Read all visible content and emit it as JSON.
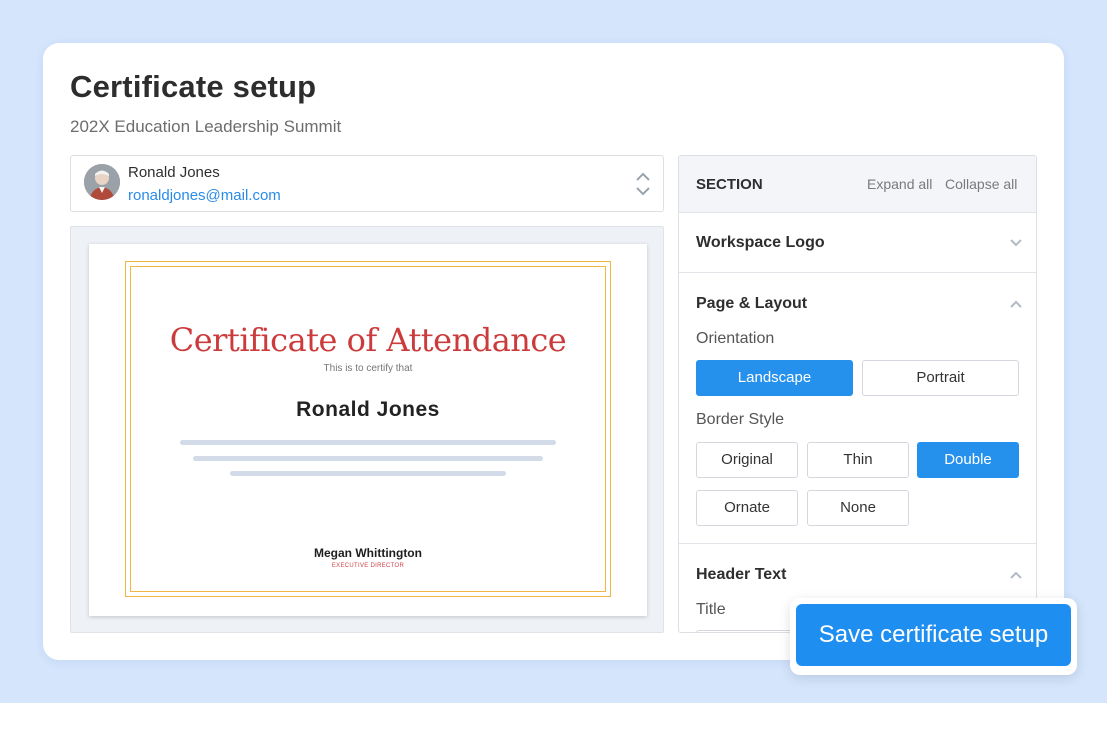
{
  "page": {
    "title": "Certificate setup",
    "subtitle": "202X Education Leadership Summit"
  },
  "user": {
    "name": "Ronald Jones",
    "email": "ronaldjones@mail.com"
  },
  "certificate": {
    "title": "Certificate of Attendance",
    "subtitle": "This is to certify that",
    "recipient": "Ronald  Jones",
    "signer_name": "Megan Whittington",
    "signer_role": "EXECUTIVE DIRECTOR",
    "border_color": "#f2b640",
    "title_color": "#cc3b3b"
  },
  "panel": {
    "header_label": "SECTION",
    "expand_all": "Expand all",
    "collapse_all": "Collapse all",
    "sections": {
      "workspace_logo": {
        "title": "Workspace Logo",
        "state": "collapsed"
      },
      "page_layout": {
        "title": "Page & Layout",
        "state": "expanded",
        "orientation_label": "Orientation",
        "orientation_options": [
          "Landscape",
          "Portrait"
        ],
        "orientation_selected": "Landscape",
        "border_style_label": "Border Style",
        "border_options": [
          "Original",
          "Thin",
          "Double",
          "Ornate",
          "None"
        ],
        "border_selected": "Double"
      },
      "header_text": {
        "title": "Header Text",
        "state": "expanded",
        "title_field_label": "Title"
      }
    }
  },
  "actions": {
    "save_label": "Save certificate setup"
  },
  "colors": {
    "accent": "#2691ec",
    "background": "#d4e5fc",
    "link": "#2a8be8"
  }
}
